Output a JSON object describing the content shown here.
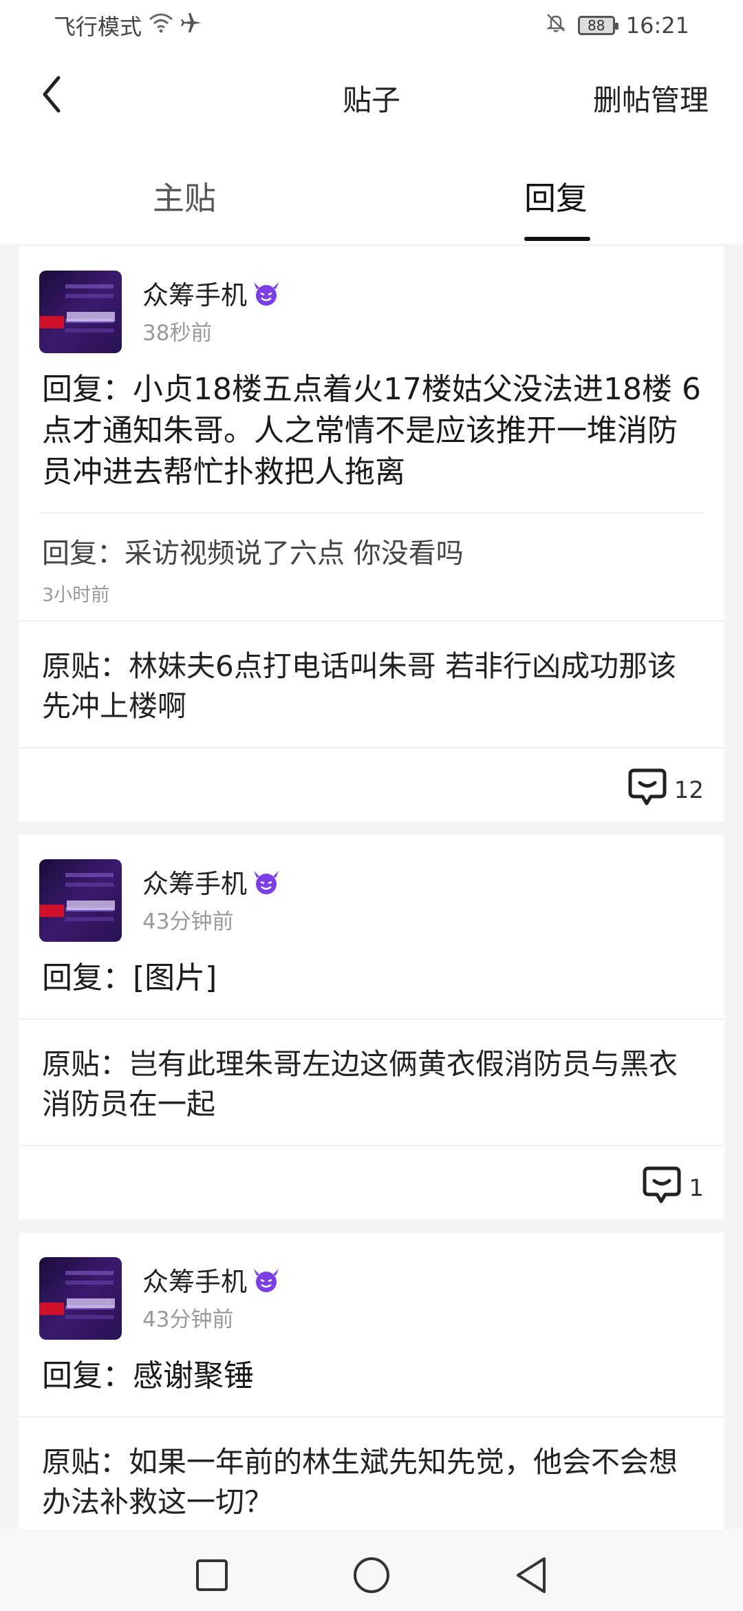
{
  "status_bar": {
    "left_text": "飞行模式",
    "battery": "88",
    "time": "16:21"
  },
  "header": {
    "title": "贴子",
    "action": "删帖管理"
  },
  "tabs": [
    {
      "label": "主贴",
      "active": false
    },
    {
      "label": "回复",
      "active": true
    }
  ],
  "posts": [
    {
      "username": "众筹手机",
      "time": "38秒前",
      "reply": "回复：小贞18楼五点着火17楼姑父没法进18楼 6点才通知朱哥。人之常情不是应该推开一堆消防员冲进去帮忙扑救把人拖离",
      "sub_reply": {
        "text": "回复：采访视频说了六点 你没看吗",
        "time": "3小时前"
      },
      "original": "原贴：林妹夫6点打电话叫朱哥 若非行凶成功那该先冲上楼啊",
      "comments": "12"
    },
    {
      "username": "众筹手机",
      "time": "43分钟前",
      "reply": "回复：[图片]",
      "original": "原贴：岂有此理朱哥左边这俩黄衣假消防员与黑衣消防员在一起",
      "comments": "1"
    },
    {
      "username": "众筹手机",
      "time": "43分钟前",
      "reply": "回复：感谢聚锤",
      "original": "原贴：如果一年前的林生斌先知先觉，他会不会想办法补救这一切？"
    }
  ],
  "icons": {
    "back": "back-chevron-icon",
    "wifi": "wifi-icon",
    "airplane": "airplane-icon",
    "mute": "bell-off-icon",
    "comment": "comment-bubble-icon",
    "devil": "smiling-devil-emoji"
  },
  "colors": {
    "accent_devil": "#7b3fe4",
    "background": "#f4f4f6",
    "card": "#ffffff"
  }
}
